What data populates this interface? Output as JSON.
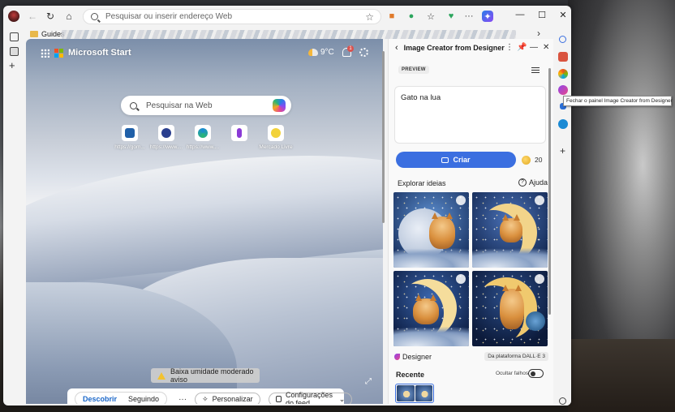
{
  "browser": {
    "address_placeholder": "Pesquisar ou inserir endereço Web",
    "favorites_folder": "Guides"
  },
  "newtab": {
    "brand": "Microsoft Start",
    "temperature": "9°C",
    "notification_count": "1",
    "search_placeholder": "Pesquisar na Web",
    "tiles": [
      {
        "label": "https://gom...",
        "color": "#1f5fa8"
      },
      {
        "label": "https://www....",
        "color": "#2a3f8f"
      },
      {
        "label": "https://www....",
        "color": "#1a8ad4"
      },
      {
        "label": "",
        "color": "#8a3ad6"
      },
      {
        "label": "Mercado Livre",
        "color": "#f2d23a"
      }
    ],
    "weather_alert": "Baixa umidade moderado aviso",
    "feed_tabs": {
      "active": "Descobrir",
      "inactive": "Seguindo"
    },
    "more": "···",
    "personalize": "Personalizar",
    "feed_settings": "Configurações do feed"
  },
  "panel": {
    "title": "Image Creator from Designer",
    "badge": "PREVIEW",
    "prompt_text": "Gato na lua",
    "create_label": "Criar",
    "boosts": "20",
    "explore_label": "Explorar ideias",
    "help_label": "Ajuda",
    "designer_label": "Designer",
    "dalle_label": "Da plataforma DALL·E 3",
    "recent_label": "Recente",
    "hide_failed_label": "Ocultar falhos"
  },
  "tooltip": "Fechar o painel Image Creator from Designer",
  "colors": {
    "accent": "#3b6fe0",
    "feed_active": "#1a67c9"
  },
  "icons": [
    "back-icon",
    "forward-icon",
    "refresh-icon",
    "home-icon",
    "search-icon",
    "star-icon",
    "copilot-icon",
    "gear-icon",
    "bell-icon",
    "sun-icon",
    "pin-icon",
    "close-icon",
    "hamburger-icon",
    "help-icon",
    "warning-icon"
  ]
}
